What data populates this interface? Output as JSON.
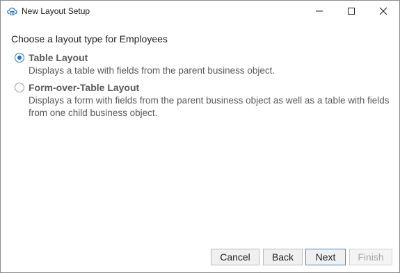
{
  "window": {
    "title": "New Layout Setup",
    "icon": "cloud-layout-icon"
  },
  "controls": {
    "minimize": "minimize-icon",
    "maximize": "maximize-icon",
    "close": "close-icon"
  },
  "main": {
    "prompt": "Choose a layout type for Employees",
    "options": [
      {
        "label": "Table Layout",
        "description": "Displays a table with fields from the parent business object.",
        "selected": true
      },
      {
        "label": "Form-over-Table Layout",
        "description": "Displays a form with fields from the parent business object as well as a table with fields from one child business object.",
        "selected": false
      }
    ]
  },
  "footer": {
    "cancel_label": "Cancel",
    "back_label": "Back",
    "next_label": "Next",
    "finish_label": "Finish",
    "finish_enabled": false
  },
  "colors": {
    "accent": "#1a73c8",
    "default_button_border": "#3c8bd6",
    "disabled_text": "#a6a6a6"
  }
}
